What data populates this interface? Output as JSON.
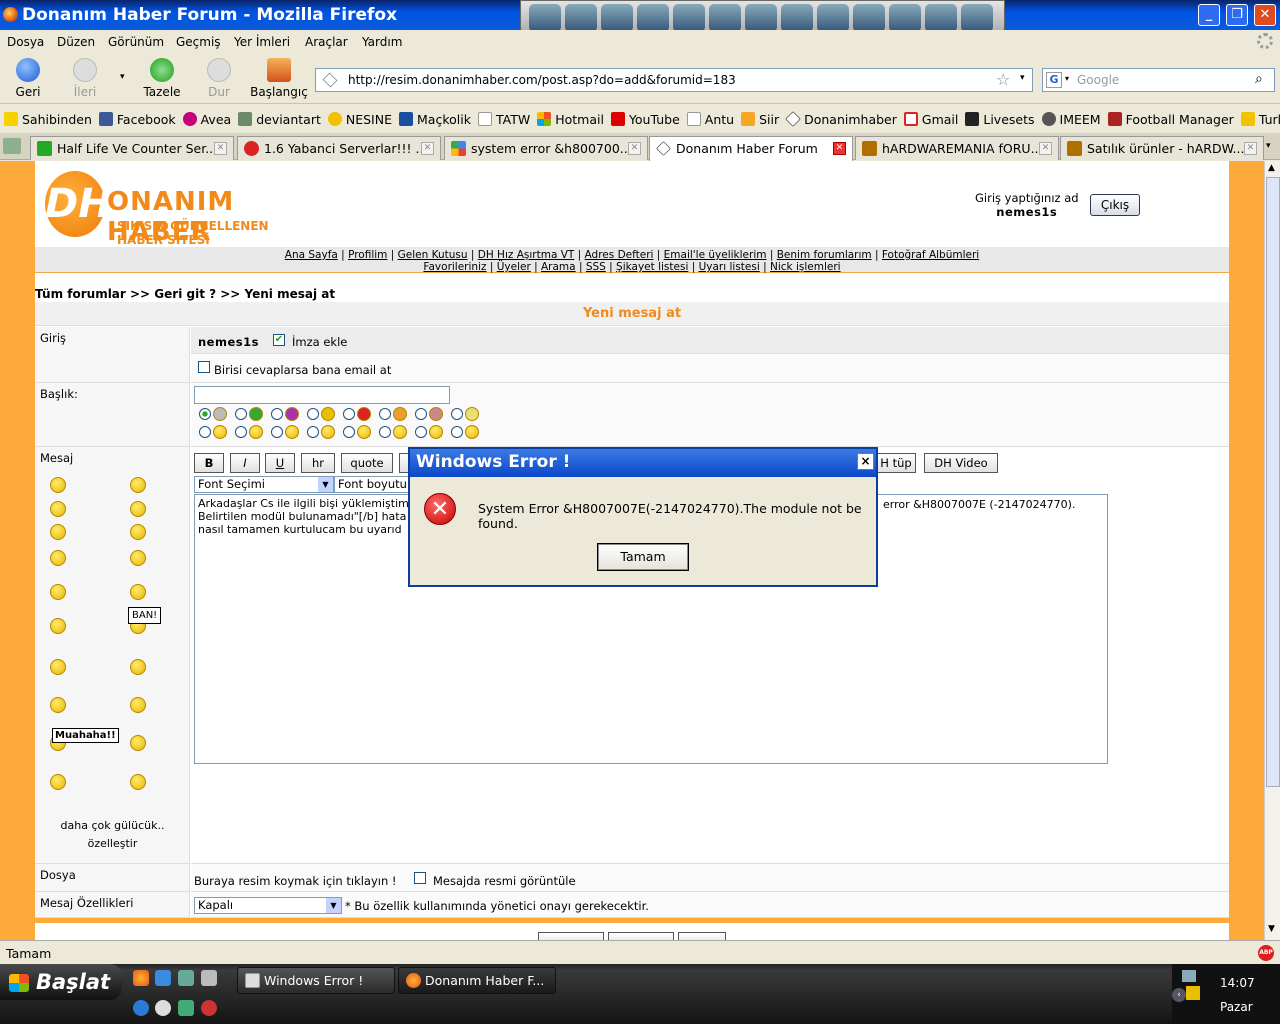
{
  "window": {
    "title": "Donanım Haber Forum - Mozilla Firefox"
  },
  "menu": [
    "Dosya",
    "Düzen",
    "Görünüm",
    "Geçmiş",
    "Yer İmleri",
    "Araçlar",
    "Yardım"
  ],
  "nav": {
    "back": "Geri",
    "forward": "İleri",
    "stop": "Dur",
    "reload": "Tazele",
    "home": "Başlangıç",
    "url": "http://resim.donanimhaber.com/post.asp?do=add&forumid=183",
    "search_placeholder": "Google"
  },
  "bookmarks": [
    "Sahibinden",
    "Facebook",
    "Avea",
    "deviantart",
    "NESINE",
    "Maçkolik",
    "TATW",
    "Hotmail",
    "YouTube",
    "Antu",
    "Siir",
    "Donanimhaber",
    "Gmail",
    "Livesets",
    "IMEEM",
    "Football Manager",
    "Turkcell"
  ],
  "tabs": [
    "Half Life Ve Counter Ser...",
    "1.6 Yabanci Serverlar!!! ...",
    "system error &h800700...",
    "Donanım Haber Forum",
    "hARDWAREMANIA fORU...",
    "Satılık ürünler - hARDW..."
  ],
  "site": {
    "logo_main": "ONANIM HABER",
    "logo_mark": "DH",
    "logo_sub": "SIK SIK GÜNCELLENEN HABER SİTESİ",
    "user_label": "Giriş yaptığınız ad",
    "username": "nemes1s",
    "logout": "Çıkış",
    "nav_row1": [
      "Ana Sayfa",
      "Profilim",
      "Gelen Kutusu",
      "DH Hız Aşırtma VT",
      "Adres Defteri",
      "Email'le üyeliklerim",
      "Benim forumlarım",
      "Fotoğraf Albümleri"
    ],
    "nav_row2": [
      "Favorileriniz",
      "Üyeler",
      "Arama",
      "SSS",
      "Şikayet listesi",
      "Uyarı listesi",
      "Nick işlemleri"
    ],
    "breadcrumb": "Tüm forumlar >> Geri git ? >> Yeni mesaj at",
    "form_title": "Yeni mesaj at"
  },
  "form": {
    "login_label": "Giriş",
    "user": "nemes1s",
    "signature": "İmza ekle",
    "notify": "Birisi cevaplarsa bana email at",
    "subject_label": "Başlık:",
    "message_label": "Mesaj",
    "buttons": [
      "B",
      "I",
      "U",
      "hr",
      "quote"
    ],
    "buttons_right": [
      "H tüp",
      "DH Video"
    ],
    "font_select": "Font Seçimi",
    "font_size": "Font boyutu",
    "message_text": "Arkadaşlar Cs ile ilgili bişi yüklemiştim\nBelirtilen modül bulunamadı\"[/b] hata\nnasıl tamamen kurtulucam bu uyarıd",
    "message_text_right": "error &H8007007E (-2147024770).",
    "more_smileys": "daha çok gülücük..",
    "customize": "özelleştir",
    "file_label": "Dosya",
    "file_text": "Buraya resim koymak için tıklayın !",
    "show_image": "Mesajda resmi görüntüle",
    "props_label": "Mesaj Özellikleri",
    "props_select": "Kapalı",
    "props_note": "* Bu özellik kullanımında yönetici onayı gerekecektir.",
    "ban_sign": "BAN!",
    "muahaha": "Muahaha!!"
  },
  "dialog": {
    "title": "Windows Error !",
    "message": "System Error &H8007007E(-2147024770).The module not be found.",
    "ok": "Tamam",
    "close": "×"
  },
  "statusbar": {
    "text": "Tamam",
    "abp": "ABP"
  },
  "taskbar": {
    "start": "Başlat",
    "items": [
      "Windows Error !",
      "Donanım Haber F..."
    ],
    "time": "14:07",
    "day": "Pazar"
  },
  "colors": {
    "orange": "#feaa3a",
    "accent": "#f28a1a",
    "xpblue": "#0054e3"
  }
}
